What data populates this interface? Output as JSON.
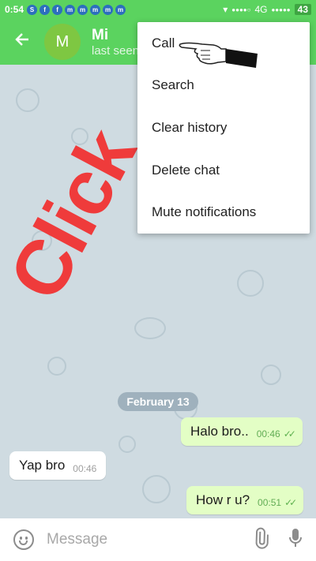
{
  "status_bar": {
    "time": "0:54",
    "notification_icons": [
      "S",
      "f",
      "f",
      "m",
      "m",
      "m",
      "m",
      "m"
    ],
    "network": "4G",
    "battery": "43",
    "signal_dots": "●●●●○",
    "signal_dots_2": "●●●●●"
  },
  "header": {
    "avatar_letter": "M",
    "chat_name": "Mi",
    "chat_status": "last seen"
  },
  "menu": {
    "items": [
      "Call",
      "Search",
      "Clear history",
      "Delete chat",
      "Mute notifications"
    ]
  },
  "overlay": {
    "click_label": "Click"
  },
  "date_chip": "February 13",
  "messages": [
    {
      "direction": "out",
      "text": "Halo bro..",
      "time": "00:46",
      "ticks": "✓✓"
    },
    {
      "direction": "in",
      "text": "Yap bro",
      "time": "00:46"
    },
    {
      "direction": "out",
      "text": "How r u?",
      "time": "00:51",
      "ticks": "✓✓"
    }
  ],
  "input": {
    "placeholder": "Message"
  },
  "colors": {
    "header_green": "#5bd35f",
    "out_bubble": "#e3fec5",
    "overlay_red": "#ef3b3b"
  },
  "icons": [
    "back-arrow-icon",
    "emoji-icon",
    "attach-icon",
    "mic-icon",
    "pointing-hand-icon"
  ]
}
